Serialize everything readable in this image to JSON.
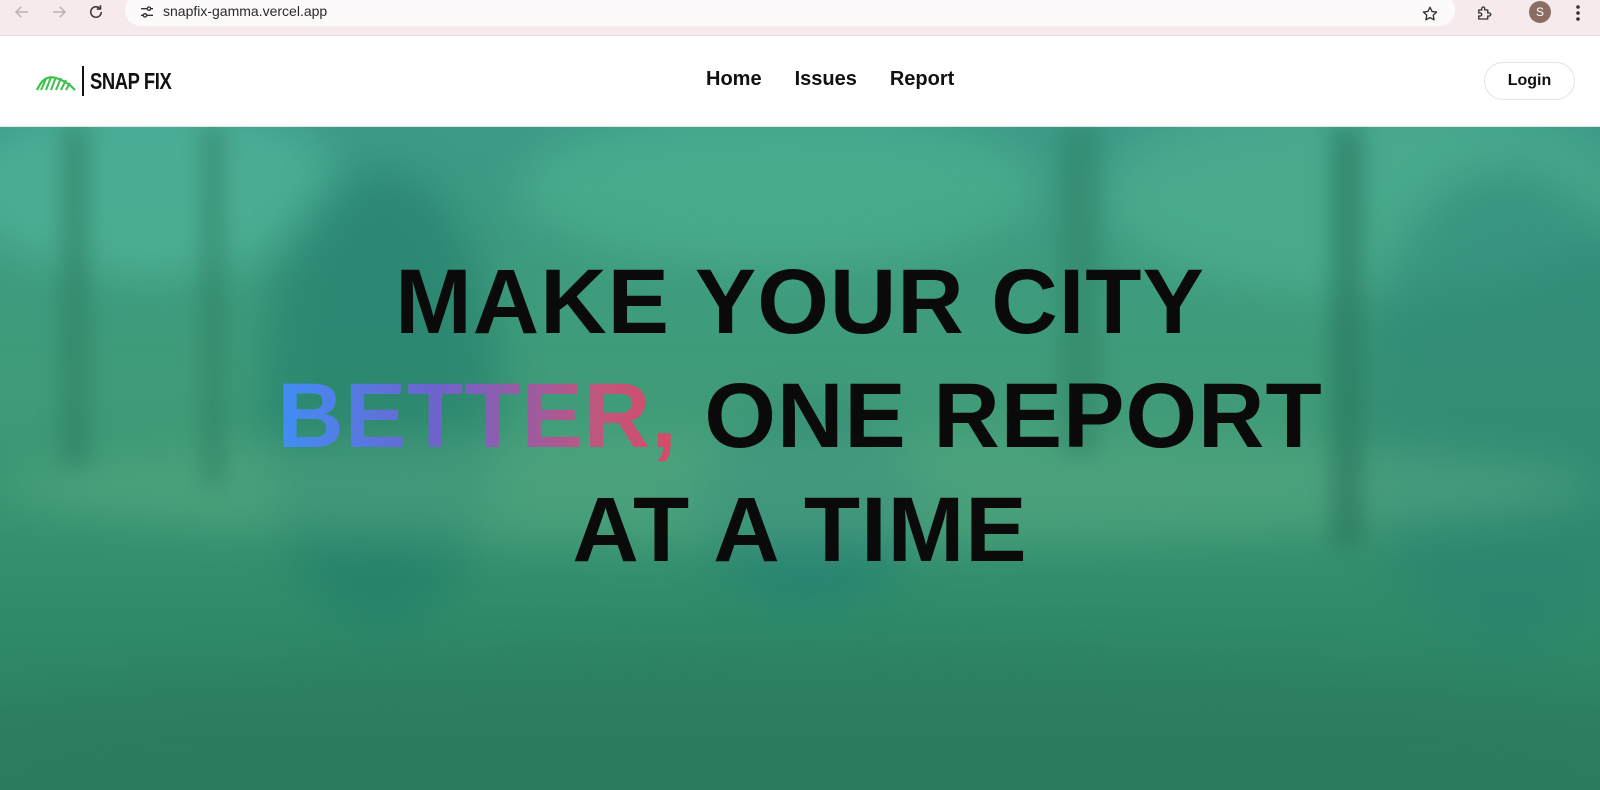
{
  "browser": {
    "url": "snapfix-gamma.vercel.app",
    "profile_initial": "S"
  },
  "header": {
    "logo_text": "SNAP FIX",
    "nav": [
      {
        "label": "Home"
      },
      {
        "label": "Issues"
      },
      {
        "label": "Report"
      }
    ],
    "login_label": "Login"
  },
  "hero": {
    "line1": "MAKE YOUR CITY",
    "line2_highlight": "BETTER,",
    "line2_rest": "ONE REPORT",
    "line3": "AT A TIME"
  },
  "colors": {
    "hero_gradient_start": "#3f8ff5",
    "hero_gradient_end": "#d64a66",
    "logo_accent": "#3cc14a"
  }
}
